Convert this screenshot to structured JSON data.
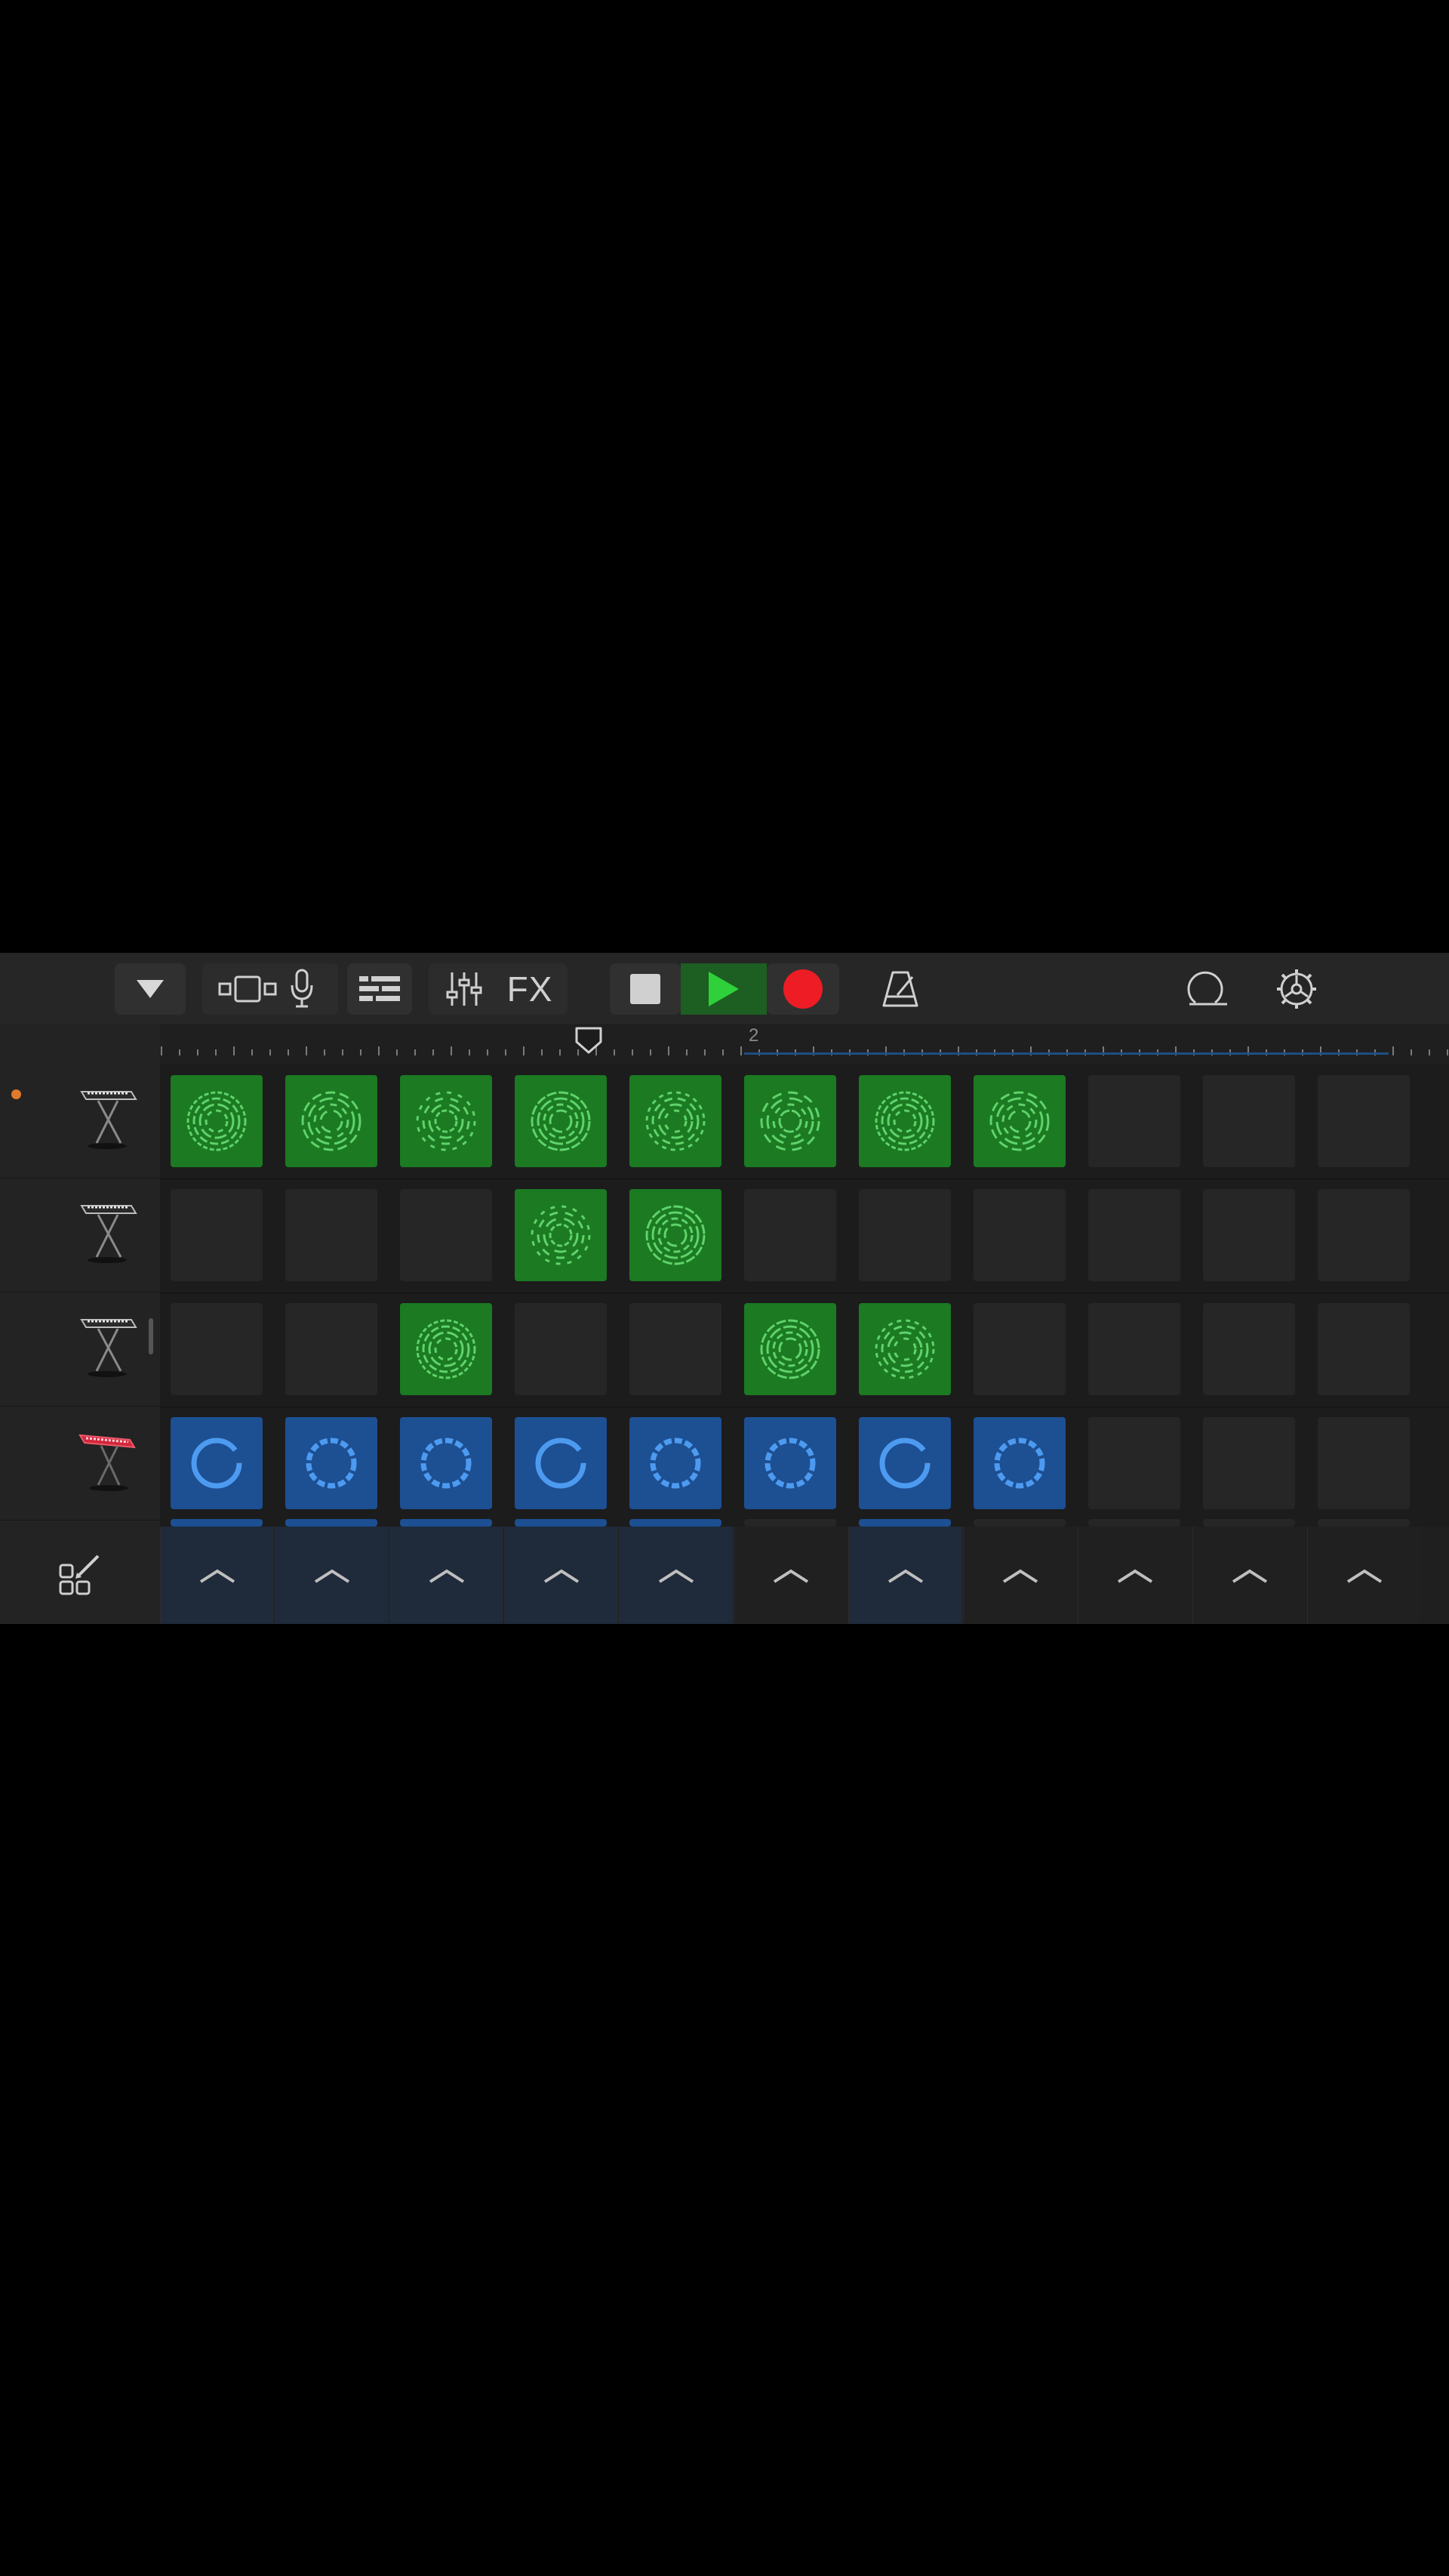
{
  "toolbar": {
    "browser_icon": "triangle-down-icon",
    "tracks_view_icon": "tracks-view-icon",
    "mic_icon": "microphone-icon",
    "live_loops_icon": "live-loops-icon",
    "mixer_icon": "mixer-sliders-icon",
    "fx_label": "FX",
    "stop_icon": "stop-icon",
    "play_icon": "play-icon",
    "record_icon": "record-icon",
    "metronome_icon": "metronome-icon",
    "loop_browser_icon": "loop-icon",
    "settings_icon": "gear-icon",
    "colors": {
      "play": "#2fd13a",
      "record": "#ee1c24",
      "play_bg": "#1d5e22"
    }
  },
  "ruler": {
    "section_number": "2",
    "add_section_label": "+"
  },
  "tracks": [
    {
      "instrument": "keyboard-stand-icon",
      "color": "#cfcfcf",
      "has_dot": true
    },
    {
      "instrument": "keyboard-stand-icon",
      "color": "#cfcfcf",
      "has_dot": false
    },
    {
      "instrument": "keyboard-stand-icon",
      "color": "#cfcfcf",
      "has_dot": false
    },
    {
      "instrument": "red-synth-keyboard-icon",
      "color": "#d0263b",
      "has_dot": false
    }
  ],
  "grid": {
    "rows": [
      [
        "green",
        "green",
        "green",
        "green",
        "green",
        "green",
        "green",
        "green",
        "empty",
        "empty",
        "empty"
      ],
      [
        "empty",
        "empty",
        "empty",
        "green",
        "green",
        "empty",
        "empty",
        "empty",
        "empty",
        "empty",
        "empty"
      ],
      [
        "empty",
        "empty",
        "green",
        "empty",
        "empty",
        "green",
        "green",
        "empty",
        "empty",
        "empty",
        "empty"
      ],
      [
        "blue",
        "blue",
        "blue",
        "blue",
        "blue",
        "blue",
        "blue",
        "blue",
        "empty",
        "empty",
        "empty"
      ]
    ],
    "peek_row": [
      true,
      true,
      true,
      true,
      true,
      false,
      true,
      false,
      false,
      false,
      false
    ]
  },
  "triggers": {
    "edit_icon": "edit-grid-icon",
    "trigger_icon": "chevron-up-icon",
    "active": [
      true,
      true,
      true,
      true,
      true,
      false,
      true,
      false,
      false,
      false,
      false
    ]
  }
}
